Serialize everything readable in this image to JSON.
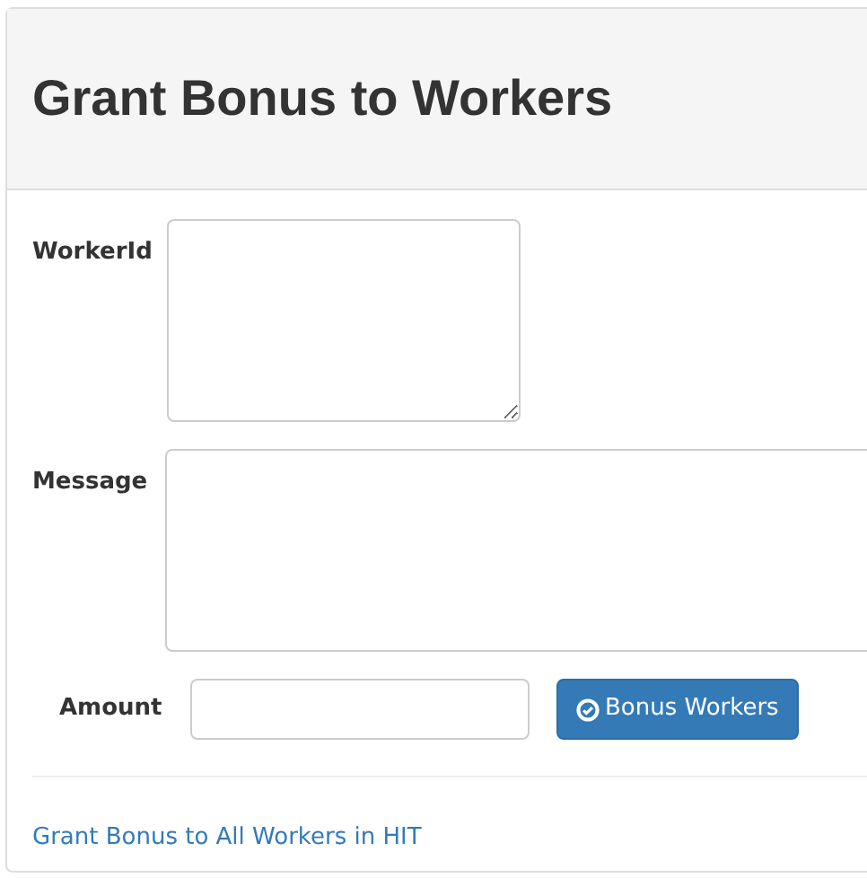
{
  "panel": {
    "title": "Grant Bonus to Workers"
  },
  "fields": [
    {
      "label": "WorkerId",
      "kind": "textarea-small"
    },
    {
      "label": "Message",
      "kind": "textarea-wide"
    }
  ],
  "amount": {
    "label": "Amount"
  },
  "submit_button": {
    "label": "Bonus Workers"
  },
  "footer_link": {
    "label": "Grant Bonus to All Workers in HIT"
  }
}
